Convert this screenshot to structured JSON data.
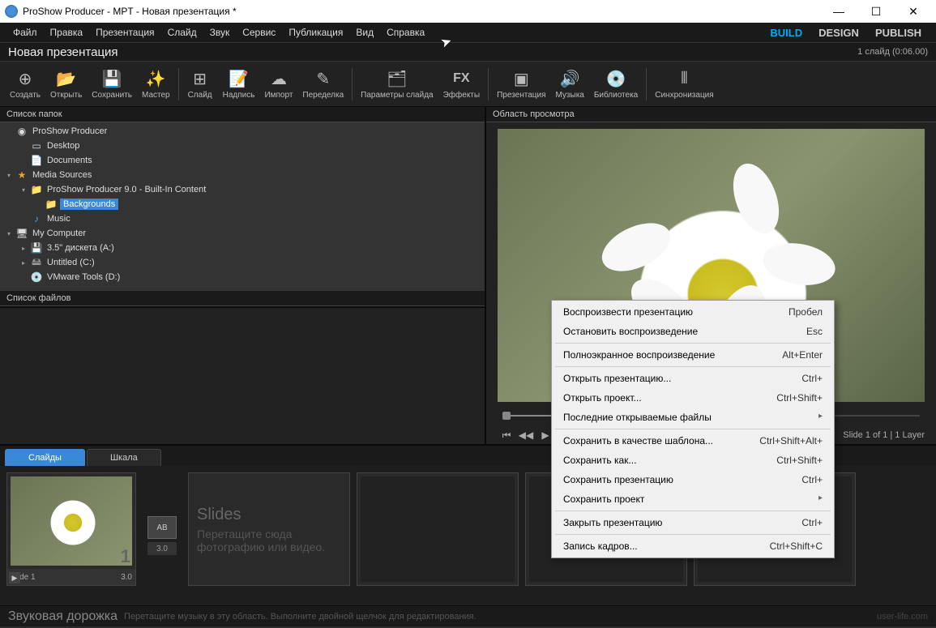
{
  "titlebar": {
    "title": "ProShow Producer - MPT - Новая презентация *"
  },
  "menu": {
    "items": [
      "Файл",
      "Правка",
      "Презентация",
      "Слайд",
      "Звук",
      "Сервис",
      "Публикация",
      "Вид",
      "Справка"
    ],
    "modes": {
      "build": "BUILD",
      "design": "DESIGN",
      "publish": "PUBLISH"
    }
  },
  "header": {
    "title": "Новая презентация",
    "status": "1 слайд (0:06.00)"
  },
  "toolbar": [
    {
      "icon": "⊕",
      "label": "Создать"
    },
    {
      "icon": "📂",
      "label": "Открыть"
    },
    {
      "icon": "💾",
      "label": "Сохранить"
    },
    {
      "icon": "✨",
      "label": "Мастер"
    },
    {
      "sep": true
    },
    {
      "icon": "⊞",
      "label": "Слайд"
    },
    {
      "icon": "📝",
      "label": "Надпись"
    },
    {
      "icon": "☁",
      "label": "Импорт"
    },
    {
      "icon": "✎",
      "label": "Переделка"
    },
    {
      "sep": true
    },
    {
      "icon": "🗂",
      "label": "Параметры слайда"
    },
    {
      "icon": "FX",
      "label": "Эффекты"
    },
    {
      "sep": true
    },
    {
      "icon": "▣",
      "label": "Презентация"
    },
    {
      "icon": "🔊",
      "label": "Музыка"
    },
    {
      "icon": "💿",
      "label": "Библиотека"
    },
    {
      "sep": true
    },
    {
      "icon": "⦀",
      "label": "Синхронизация"
    }
  ],
  "panels": {
    "folders_title": "Список папок",
    "files_title": "Список файлов",
    "preview_title": "Область просмотра"
  },
  "folders": [
    {
      "depth": 0,
      "chev": "",
      "icon": "◉",
      "iconcls": "",
      "label": "ProShow Producer"
    },
    {
      "depth": 1,
      "chev": "",
      "icon": "▭",
      "iconcls": "",
      "label": "Desktop"
    },
    {
      "depth": 1,
      "chev": "",
      "icon": "📄",
      "iconcls": "",
      "label": "Documents"
    },
    {
      "depth": 0,
      "chev": "▾",
      "icon": "★",
      "iconcls": "icon-star",
      "label": "Media Sources"
    },
    {
      "depth": 1,
      "chev": "▾",
      "icon": "📁",
      "iconcls": "icon-folder",
      "label": "ProShow Producer 9.0 - Built-In Content"
    },
    {
      "depth": 2,
      "chev": "",
      "icon": "📁",
      "iconcls": "icon-folder",
      "label": "Backgrounds",
      "sel": true
    },
    {
      "depth": 1,
      "chev": "",
      "icon": "♪",
      "iconcls": "icon-music",
      "label": "Music"
    },
    {
      "depth": 0,
      "chev": "▾",
      "icon": "🖥",
      "iconcls": "",
      "label": "My Computer"
    },
    {
      "depth": 1,
      "chev": "▸",
      "icon": "💾",
      "iconcls": "icon-drive",
      "label": "3.5\" дискета (A:)"
    },
    {
      "depth": 1,
      "chev": "▸",
      "icon": "🖴",
      "iconcls": "icon-drive",
      "label": "Untitled (C:)"
    },
    {
      "depth": 1,
      "chev": "",
      "icon": "💿",
      "iconcls": "icon-drive",
      "label": "VMware Tools (D:)"
    }
  ],
  "preview": {
    "slide_info": "Slide 1 of 1  |  1 Layer"
  },
  "tabs": {
    "slides": "Слайды",
    "scale": "Шкала"
  },
  "slide1": {
    "name": "Slide 1",
    "dur": "3.0",
    "trans": "AB",
    "trans_dur": "3.0",
    "number": "1"
  },
  "placeholder": {
    "title": "Slides",
    "line1": "Перетащите сюда",
    "line2": "фотографию или видео."
  },
  "footer": {
    "title": "Звуковая дорожка",
    "hint": "Перетащите музыку в эту область. Выполните двойной щелчок для редактирования.",
    "watermark": "user-life.com"
  },
  "context_menu": [
    {
      "label": "Воспроизвести презентацию",
      "shortcut": "Пробел"
    },
    {
      "label": "Остановить воспроизведение",
      "shortcut": "Esc"
    },
    {
      "sep": true
    },
    {
      "label": "Полноэкранное воспроизведение",
      "shortcut": "Alt+Enter"
    },
    {
      "sep": true
    },
    {
      "label": "Открыть презентацию...",
      "shortcut": "Ctrl+"
    },
    {
      "label": "Открыть проект...",
      "shortcut": "Ctrl+Shift+"
    },
    {
      "label": "Последние открываемые файлы",
      "shortcut": "",
      "arrow": true
    },
    {
      "sep": true
    },
    {
      "label": "Сохранить в качестве шаблона...",
      "shortcut": "Ctrl+Shift+Alt+"
    },
    {
      "label": "Сохранить как...",
      "shortcut": "Ctrl+Shift+"
    },
    {
      "label": "Сохранить презентацию",
      "shortcut": "Ctrl+"
    },
    {
      "label": "Сохранить проект",
      "shortcut": "",
      "arrow": true
    },
    {
      "sep": true
    },
    {
      "label": "Закрыть презентацию",
      "shortcut": "Ctrl+"
    },
    {
      "sep": true
    },
    {
      "label": "Запись кадров...",
      "shortcut": "Ctrl+Shift+C"
    }
  ]
}
